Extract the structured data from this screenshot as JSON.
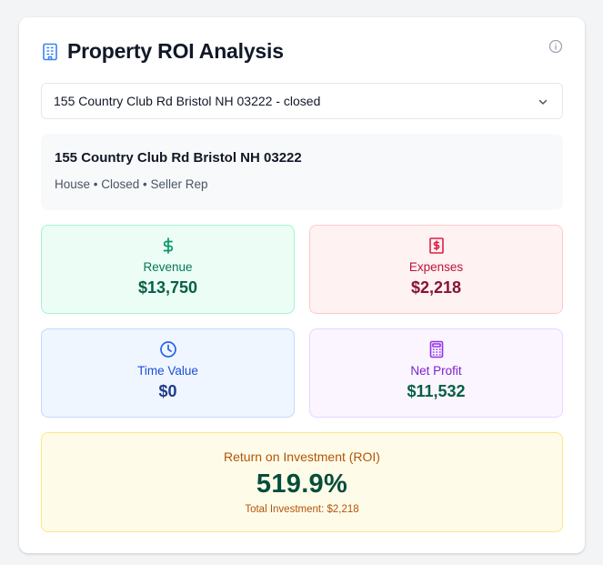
{
  "header": {
    "title": "Property ROI Analysis"
  },
  "property_select": {
    "selected": "155 Country Club Rd Bristol NH 03222 - closed"
  },
  "property": {
    "address": "155 Country Club Rd Bristol NH 03222",
    "meta": "House • Closed • Seller Rep"
  },
  "stats": {
    "revenue": {
      "label": "Revenue",
      "value": "$13,750"
    },
    "expenses": {
      "label": "Expenses",
      "value": "$2,218"
    },
    "time_value": {
      "label": "Time Value",
      "value": "$0"
    },
    "net_profit": {
      "label": "Net Profit",
      "value": "$11,532"
    }
  },
  "roi": {
    "label": "Return on Investment (ROI)",
    "value": "519.9%",
    "total_investment": "Total Investment: $2,218"
  },
  "colors": {
    "revenue_accent": "#059669",
    "expenses_accent": "#e11d48",
    "time_accent": "#2563eb",
    "net_accent": "#9333ea",
    "roi_accent": "#d97706",
    "building_icon": "#3b82f6"
  },
  "icons": {
    "header": "building-icon",
    "info": "info-icon",
    "select": "chevron-down-icon",
    "revenue": "dollar-sign-icon",
    "expenses": "receipt-icon",
    "time_value": "clock-icon",
    "net_profit": "calculator-icon"
  }
}
